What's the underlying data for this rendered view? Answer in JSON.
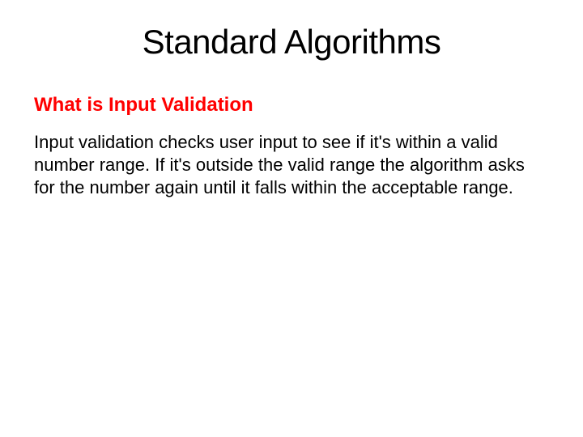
{
  "title": "Standard Algorithms",
  "subtitle": "What is Input Validation",
  "body": "Input validation checks user input to see if it's within a valid number range. If it's outside the valid range the algorithm asks for the number again until it falls within the acceptable range."
}
